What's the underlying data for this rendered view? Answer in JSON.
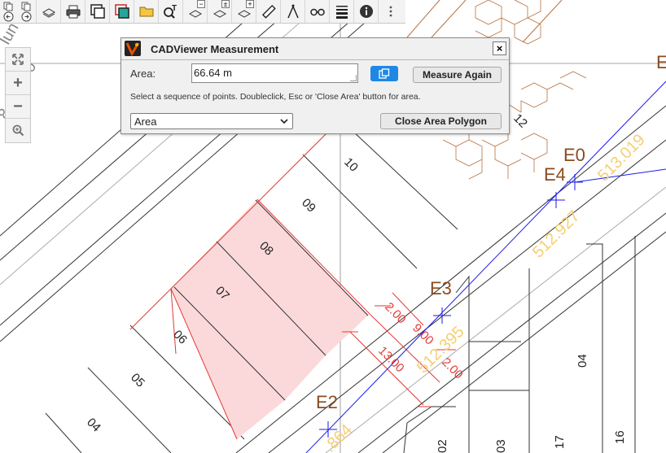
{
  "window": {
    "title": "CADViewer Measurement"
  },
  "toolbar": {
    "items": [
      "nav-back",
      "nav-forward",
      "layers",
      "print",
      "window-zoom",
      "screen-capture",
      "open-file",
      "text-search",
      "cube-minus",
      "cube-plus-minus",
      "cube-plus",
      "ruler",
      "compass",
      "glasses",
      "line-weight",
      "info",
      "more"
    ]
  },
  "zoombar": {
    "items": [
      "extents",
      "zoom-in",
      "zoom-out",
      "zoom-window"
    ],
    "plus": "+",
    "minus": "−"
  },
  "dialog": {
    "title": "CADViewer Measurement",
    "close_glyph": "×",
    "area_label": "Area:",
    "area_value": "66.64 m",
    "measure_again": "Measure Again",
    "instruction": "Select a sequence of points. Doubleclick, Esc or 'Close Area' button for area.",
    "mode_selected": "Area",
    "close_area": "Close Area Polygon"
  },
  "drawing": {
    "lot_numbers": [
      "04",
      "05",
      "06",
      "07",
      "08",
      "09",
      "10",
      "12",
      "04",
      "16",
      "17",
      "03",
      "02"
    ],
    "points": [
      "E0",
      "E4",
      "E3",
      "E2",
      "E"
    ],
    "elevations": [
      "513.019",
      "512.927",
      "512.395",
      ".864"
    ],
    "dimensions": [
      "2.00",
      "9.00",
      "2.00",
      "13.00"
    ],
    "colors": {
      "lines": "#222222",
      "red": "#e53935",
      "blue": "#1a1aee",
      "pink_fill": "#fbd9da",
      "brown": "#9c5b2e",
      "gold": "#f4cf73"
    }
  }
}
